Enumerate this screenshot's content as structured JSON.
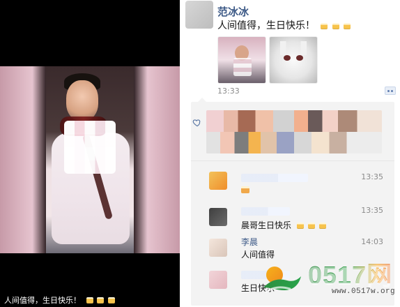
{
  "viewer": {
    "caption_text": "人间值得，生日快乐！",
    "caption_emojis": [
      "cake-icon",
      "cake-icon",
      "cake-icon"
    ]
  },
  "post": {
    "author": "范冰冰",
    "text": "人间值得，生日快乐！",
    "text_emojis": [
      "cake-icon",
      "cake-icon",
      "cake-icon"
    ],
    "time": "13:33"
  },
  "comments": [
    {
      "time": "13:35",
      "text": "",
      "emoji": "cake-icon"
    },
    {
      "time": "13:35",
      "text": "晨哥生日快乐",
      "text_emojis": [
        "cake-icon",
        "cake-icon",
        "cake-icon"
      ]
    },
    {
      "name": "李晨",
      "time": "14:03",
      "text": "人间值得"
    },
    {
      "time": "",
      "text": "生日快乐"
    }
  ],
  "watermark": {
    "brand": "0517网",
    "url": "www.0517w.org"
  },
  "colors": {
    "name_blue": "#3d5a87",
    "panel_bg": "#f3f3f3",
    "time_gray": "#8a8a8a"
  }
}
